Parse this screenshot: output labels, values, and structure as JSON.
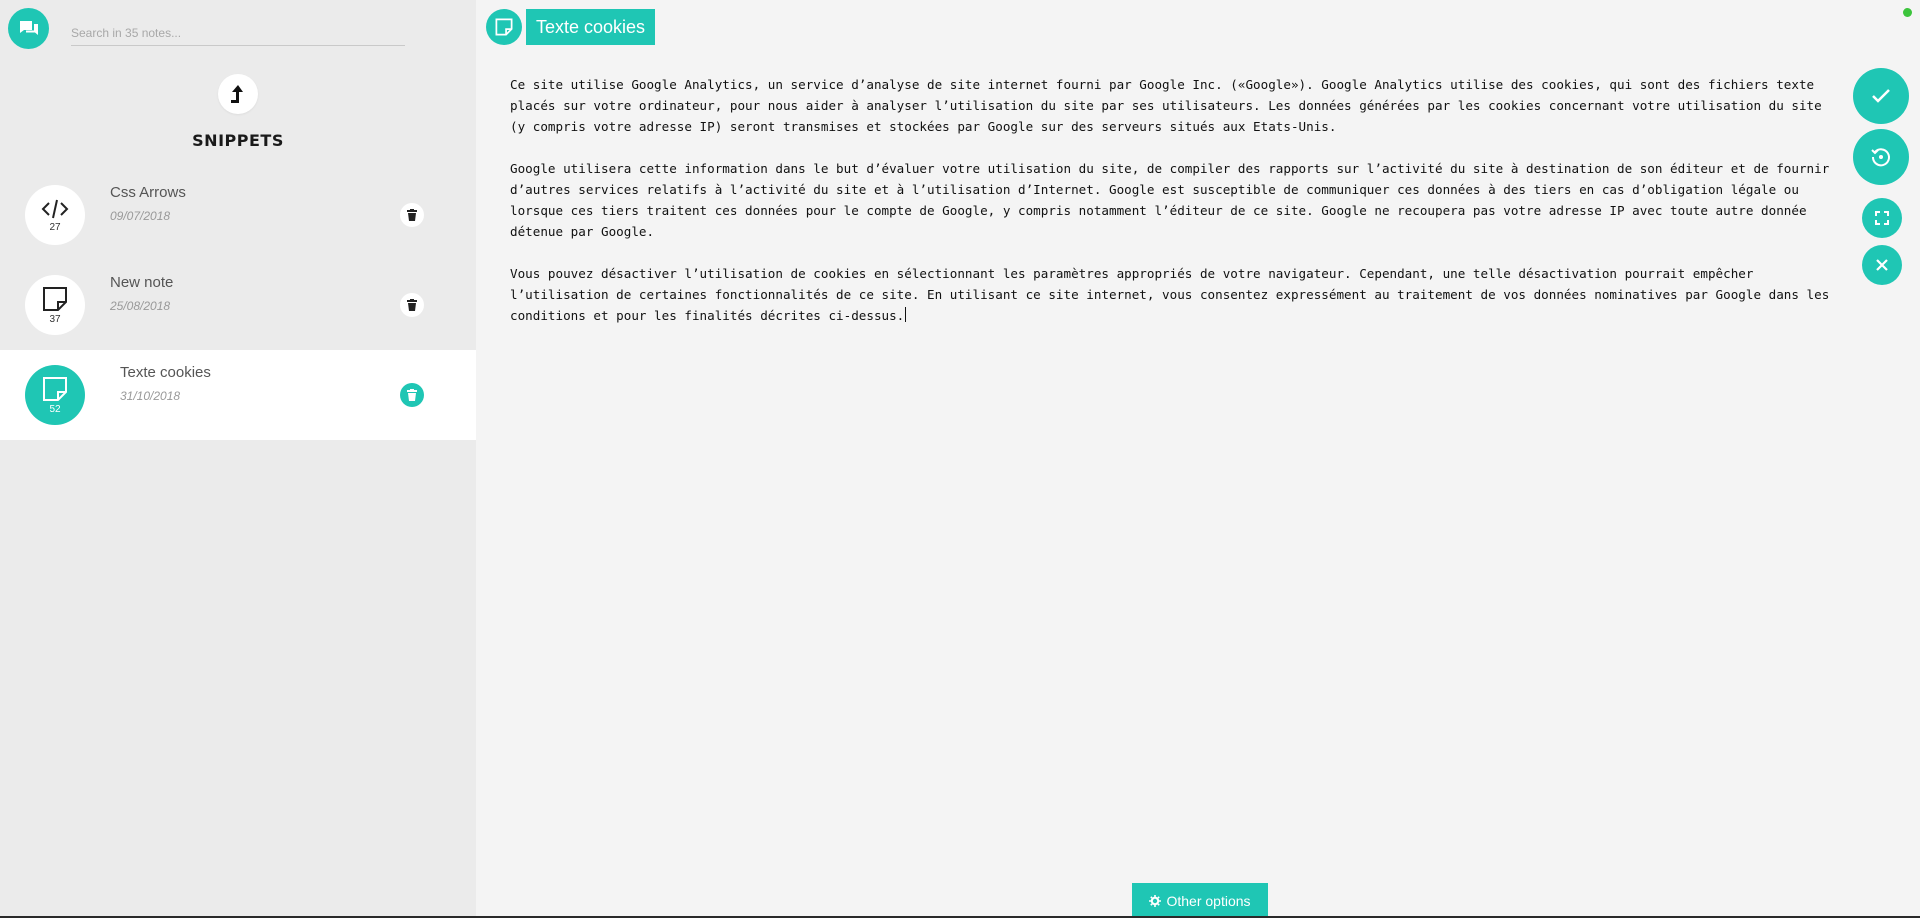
{
  "sidebar": {
    "logo_icon": "chat-bubbles-icon",
    "search": {
      "placeholder": "Search in 35 notes...",
      "value": ""
    },
    "up_icon": "arrow-up-left-icon",
    "folder_title": "SNIPPETS",
    "notes": [
      {
        "title": "Css Arrows",
        "date": "09/07/2018",
        "count": "27",
        "icon": "code-icon",
        "active": false
      },
      {
        "title": "New note",
        "date": "25/08/2018",
        "count": "37",
        "icon": "note-icon",
        "active": false
      },
      {
        "title": "Texte cookies",
        "date": "31/10/2018",
        "count": "52",
        "icon": "note-icon",
        "active": true
      }
    ],
    "delete_icon": "trash-icon"
  },
  "editor": {
    "title": "Texte cookies",
    "title_icon": "note-icon",
    "paragraphs": [
      "Ce site utilise Google Analytics, un service d’analyse de site internet fourni par Google Inc. («Google»). Google Analytics utilise des cookies, qui sont des fichiers texte placés sur votre ordinateur, pour nous aider à analyser l’utilisation du site par ses utilisateurs. Les données générées par les cookies concernant votre utilisation du site (y compris votre adresse IP) seront transmises et stockées par Google sur des serveurs situés aux Etats-Unis.",
      "Google utilisera cette information dans le but d’évaluer votre utilisation du site, de compiler des rapports sur l’activité du site à destination de son éditeur et de fournir d’autres services relatifs à l’activité du site et à l’utilisation d’Internet. Google est susceptible de communiquer ces données à des tiers en cas d’obligation légale ou lorsque ces tiers traitent ces données pour le compte de Google, y compris notamment l’éditeur de ce site. Google ne recoupera pas votre adresse IP avec toute autre donnée détenue par Google.",
      "Vous pouvez désactiver l’utilisation de cookies en sélectionnant les paramètres appropriés de votre navigateur. Cependant, une telle désactivation pourrait empêcher l’utilisation de certaines fonctionnalités de ce site. En utilisant ce site internet, vous consentez expressément au traitement de vos données nominatives par Google dans les conditions et pour les finalités décrites ci-dessus."
    ]
  },
  "actions": {
    "save_icon": "check-icon",
    "history_icon": "history-icon",
    "fullscreen_icon": "fullscreen-icon",
    "close_icon": "close-icon"
  },
  "footer": {
    "other_options_label": "Other options",
    "other_options_icon": "gear-icon"
  },
  "colors": {
    "accent": "#1fc6b4",
    "sidebar_bg": "#ebebeb",
    "editor_bg": "#f4f4f4",
    "status": "#3cc43c"
  }
}
